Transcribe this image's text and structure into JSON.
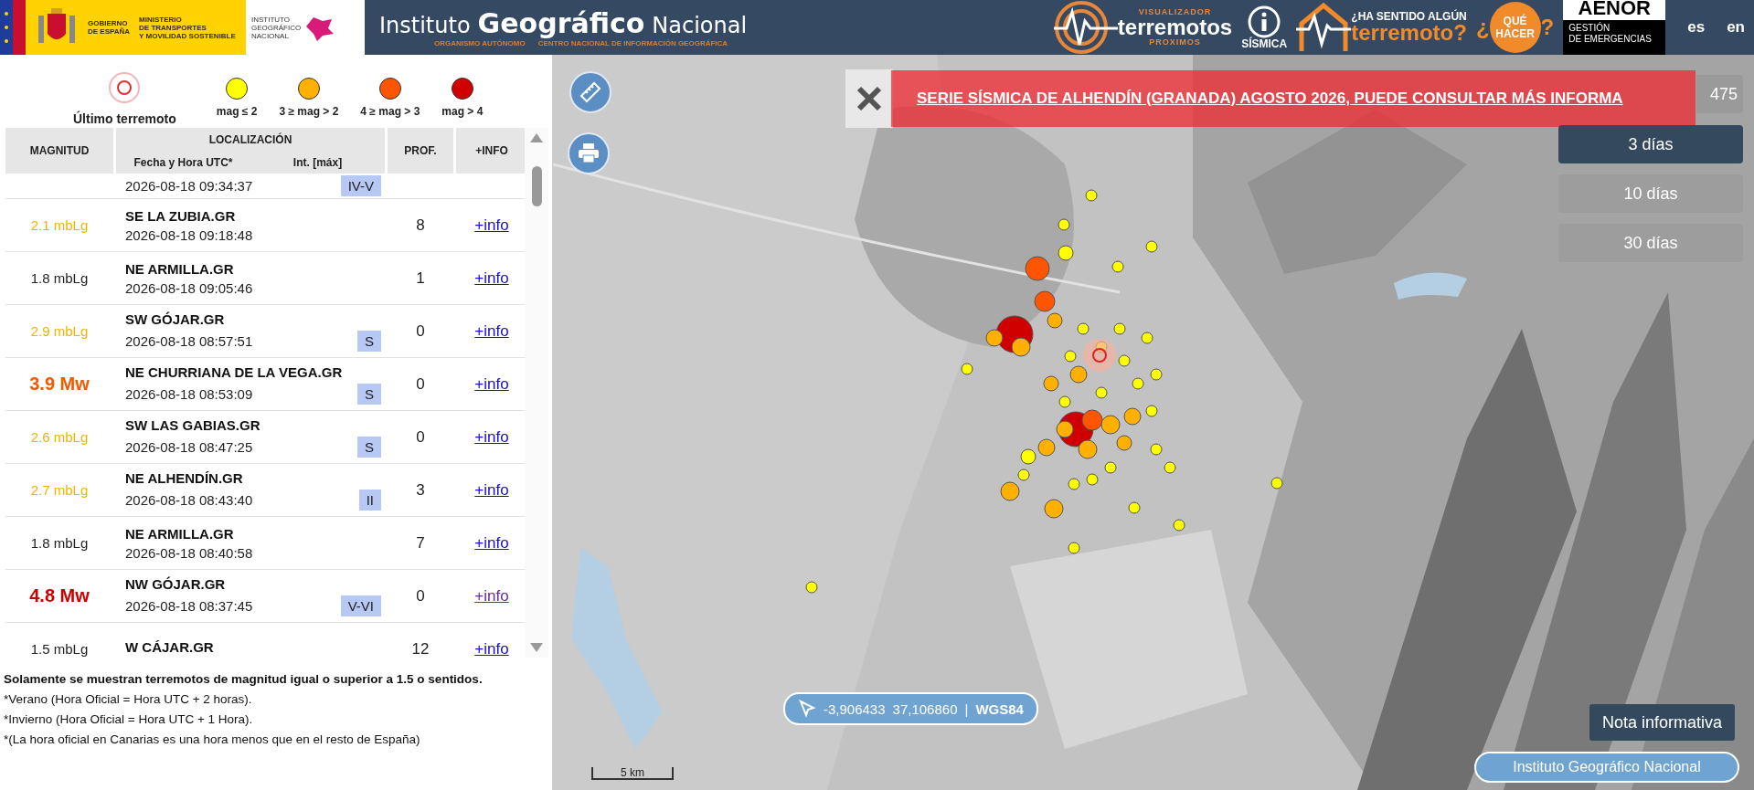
{
  "header": {
    "government": [
      "GOBIERNO",
      "DE ESPAÑA"
    ],
    "ministry": [
      "MINISTERIO",
      "DE TRANSPORTES",
      "Y MOVILIDAD SOSTENIBLE"
    ],
    "institute_small": [
      "INSTITUTO",
      "GEOGRÁFICO",
      "NACIONAL"
    ],
    "site_title": [
      "Instituto",
      "Geográfico",
      "Nacional"
    ],
    "site_subtitle": [
      "ORGANISMO AUTÓNOMO",
      "CENTRO NACIONAL DE INFORMACIÓN GEOGRÁFICA"
    ],
    "quake_viewer": {
      "top": "VISUALIZADOR",
      "main": "terremotos",
      "bottom": "PROXIMOS"
    },
    "seismic_info": "SÍSMICA",
    "felt": {
      "top": "¿HA SENTIDO ALGÚN",
      "main": "terremoto?"
    },
    "what_to_do": {
      "open": "¿",
      "lines": [
        "QUÉ",
        "HACER"
      ],
      "close": "?"
    },
    "aenor": {
      "brand": "AENOR",
      "lines": [
        "GESTIÓN",
        "DE EMERGENCIAS"
      ]
    },
    "languages": [
      "es",
      "en"
    ]
  },
  "legend": [
    {
      "kind": "latest",
      "label": "Último terremoto"
    },
    {
      "kind": "dot",
      "label": "mag ≤ 2",
      "color": "#ffff00"
    },
    {
      "kind": "dot",
      "label": "3 ≥ mag > 2",
      "color": "#ffb000"
    },
    {
      "kind": "dot",
      "label": "4 ≥ mag > 3",
      "color": "#ff5500"
    },
    {
      "kind": "dot",
      "label": "mag > 4",
      "color": "#d00000"
    }
  ],
  "table": {
    "columns": {
      "magnitude": "MAGNITUD",
      "location": "LOCALIZACIÓN",
      "datetime": "Fecha y Hora UTC*",
      "intensity": "Int. [máx]",
      "depth": "PROF.",
      "info": "+INFO"
    },
    "rows": [
      {
        "kind": "cut_top",
        "datetime": "2026-08-18 09:34:37",
        "intensity": "IV-V"
      },
      {
        "kind": "full",
        "magnitude": "2.1 mbLg",
        "color": "#f0b400",
        "strong": false,
        "location": "SE LA ZUBIA.GR",
        "datetime": "2026-08-18 09:18:48",
        "depth": "8",
        "info": "+info",
        "visited": false
      },
      {
        "kind": "full",
        "magnitude": "1.8 mbLg",
        "color": "#222222",
        "strong": false,
        "location": "NE ARMILLA.GR",
        "datetime": "2026-08-18 09:05:46",
        "depth": "1",
        "info": "+info",
        "visited": false
      },
      {
        "kind": "full",
        "magnitude": "2.9 mbLg",
        "color": "#f0b400",
        "strong": false,
        "location": "SW GÓJAR.GR",
        "datetime": "2026-08-18 08:57:51",
        "intensity": "S",
        "depth": "0",
        "info": "+info",
        "visited": false
      },
      {
        "kind": "full",
        "magnitude": "3.9 Mw",
        "color": "#f05a00",
        "strong": true,
        "location": "NE CHURRIANA DE LA VEGA.GR",
        "datetime": "2026-08-18 08:53:09",
        "intensity": "S",
        "depth": "0",
        "info": "+info",
        "visited": false
      },
      {
        "kind": "full",
        "magnitude": "2.6 mbLg",
        "color": "#f0b400",
        "strong": false,
        "location": "SW LAS GABIAS.GR",
        "datetime": "2026-08-18 08:47:25",
        "intensity": "S",
        "depth": "0",
        "info": "+info",
        "visited": false
      },
      {
        "kind": "full",
        "magnitude": "2.7 mbLg",
        "color": "#f0b400",
        "strong": false,
        "location": "NE ALHENDÍN.GR",
        "datetime": "2026-08-18 08:43:40",
        "intensity": "II",
        "depth": "3",
        "info": "+info",
        "visited": false
      },
      {
        "kind": "full",
        "magnitude": "1.8 mbLg",
        "color": "#222222",
        "strong": false,
        "location": "NE ARMILLA.GR",
        "datetime": "2026-08-18 08:40:58",
        "depth": "7",
        "info": "+info",
        "visited": false
      },
      {
        "kind": "full",
        "magnitude": "4.8 Mw",
        "color": "#cc0000",
        "strong": true,
        "location": "NW GÓJAR.GR",
        "datetime": "2026-08-18 08:37:45",
        "intensity": "V-VI",
        "depth": "0",
        "info": "+info",
        "visited": true
      },
      {
        "kind": "full",
        "magnitude": "1.5 mbLg",
        "color": "#222222",
        "strong": false,
        "location": "W CÁJAR.GR",
        "depth": "12",
        "info": "+info",
        "visited": false
      }
    ]
  },
  "notes": [
    {
      "text": "Solamente se muestran terremotos de magnitud igual o superior a 1.5 o sentidos.",
      "strong": true
    },
    {
      "text": "*Verano (Hora Oficial = Hora UTC + 2 horas).",
      "strong": false
    },
    {
      "text": "*Invierno (Hora Oficial = Hora UTC + 1 Hora).",
      "strong": false
    },
    {
      "text": "*(La hora oficial en Canarias es una hora menos que en el resto de España)",
      "strong": false
    }
  ],
  "map": {
    "banner": "SERIE SÍSMICA DE ALHENDÍN (GRANADA) AGOSTO 2026, PUEDE CONSULTAR MÁS INFORMA",
    "hidden_button": "475",
    "periods": [
      {
        "label": "3 días",
        "selected": true
      },
      {
        "label": "10 días",
        "selected": false
      },
      {
        "label": "30 días",
        "selected": false
      }
    ],
    "coordinates": {
      "lon": "-3,906433",
      "lat": "37,106860",
      "separator": "|",
      "crs": "WGS84"
    },
    "scale": "5 km",
    "note_button": "Nota informativa",
    "attribution": "Instituto Geográfico Nacional"
  }
}
